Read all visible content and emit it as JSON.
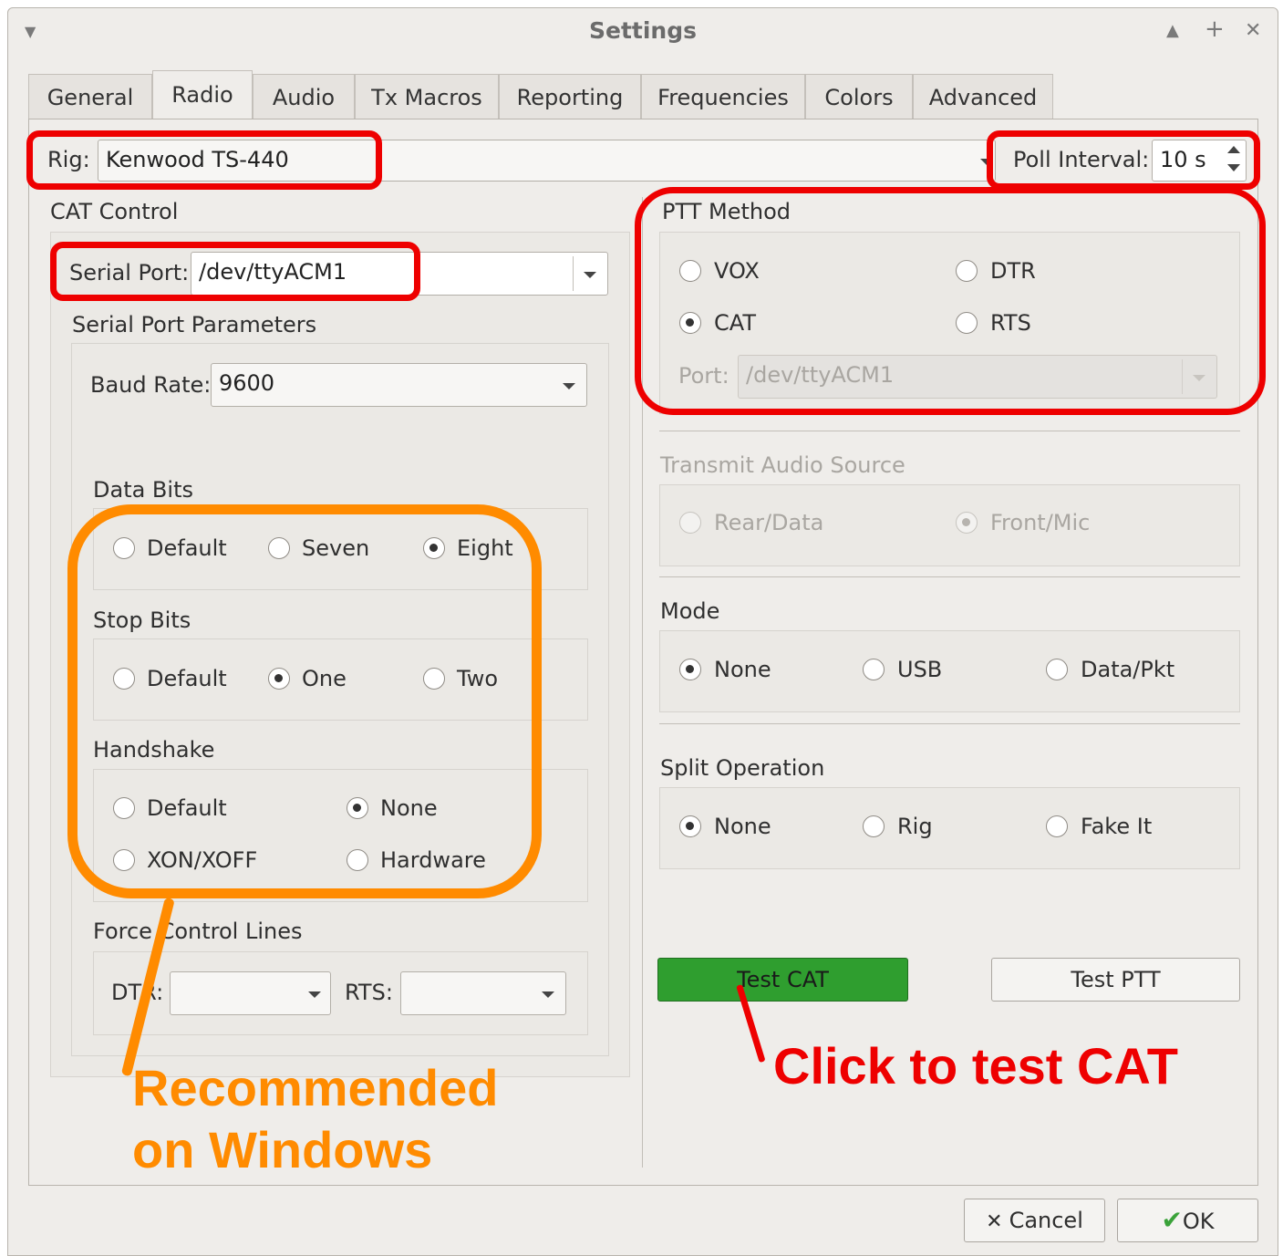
{
  "window": {
    "title": "Settings",
    "controls": {
      "shade": "▲",
      "maximize": "+",
      "close": "✕"
    },
    "menu_icon": "▼"
  },
  "tabs": [
    "General",
    "Radio",
    "Audio",
    "Tx Macros",
    "Reporting",
    "Frequencies",
    "Colors",
    "Advanced"
  ],
  "active_tab": "Radio",
  "rig": {
    "label": "Rig:",
    "value": "Kenwood TS-440"
  },
  "poll": {
    "label": "Poll Interval:",
    "value": "10 s"
  },
  "cat_control": {
    "title": "CAT Control",
    "serial_port_label": "Serial Port:",
    "serial_port_value": "/dev/ttyACM1",
    "params_title": "Serial Port Parameters",
    "baud_label": "Baud Rate:",
    "baud_value": "9600",
    "data_bits": {
      "title": "Data Bits",
      "options": [
        "Default",
        "Seven",
        "Eight"
      ],
      "selected": "Eight"
    },
    "stop_bits": {
      "title": "Stop Bits",
      "options": [
        "Default",
        "One",
        "Two"
      ],
      "selected": "One"
    },
    "handshake": {
      "title": "Handshake",
      "options": [
        "Default",
        "None",
        "XON/XOFF",
        "Hardware"
      ],
      "selected": "None"
    },
    "force_lines": {
      "title": "Force Control Lines",
      "dtr_label": "DTR:",
      "rts_label": "RTS:",
      "dtr_value": "",
      "rts_value": ""
    }
  },
  "ptt": {
    "title": "PTT Method",
    "options": [
      "VOX",
      "DTR",
      "CAT",
      "RTS"
    ],
    "selected": "CAT",
    "port_label": "Port:",
    "port_value": "/dev/ttyACM1"
  },
  "tx_audio": {
    "title": "Transmit Audio Source",
    "options": [
      "Rear/Data",
      "Front/Mic"
    ],
    "selected": "Front/Mic"
  },
  "mode": {
    "title": "Mode",
    "options": [
      "None",
      "USB",
      "Data/Pkt"
    ],
    "selected": "None"
  },
  "split": {
    "title": "Split Operation",
    "options": [
      "None",
      "Rig",
      "Fake It"
    ],
    "selected": "None"
  },
  "buttons": {
    "test_cat": "Test CAT",
    "test_ptt": "Test PTT",
    "cancel": "Cancel",
    "ok": "OK"
  },
  "annotations": {
    "click_to_test": "Click to test CAT",
    "recommended_line1": "Recommended",
    "recommended_line2": "on Windows"
  },
  "colors": {
    "test_cat_bg": "#2f9e2f",
    "annotation_red": "#ee0000",
    "annotation_orange": "#ff8b00"
  }
}
